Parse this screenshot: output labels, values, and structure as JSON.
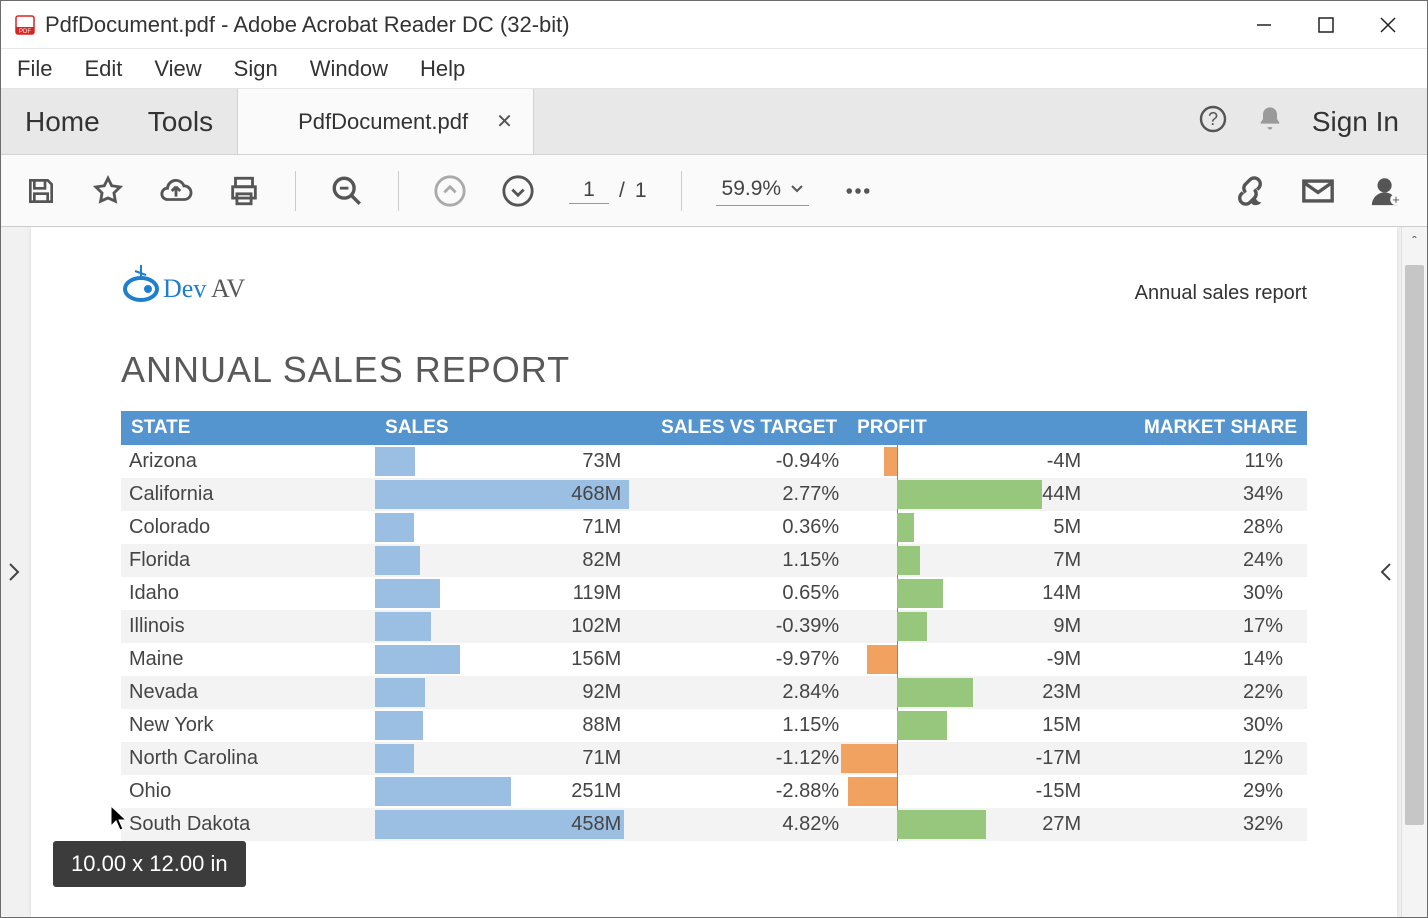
{
  "window": {
    "title": "PdfDocument.pdf - Adobe Acrobat Reader DC (32-bit)"
  },
  "menu": [
    "File",
    "Edit",
    "View",
    "Sign",
    "Window",
    "Help"
  ],
  "tabs": {
    "home": "Home",
    "tools": "Tools",
    "doc": "PdfDocument.pdf"
  },
  "signin": "Sign In",
  "toolbar": {
    "page_current": "1",
    "page_sep": "/",
    "page_total": "1",
    "zoom": "59.9%"
  },
  "doc": {
    "logo_text": "DevAV",
    "subtitle": "Annual sales report",
    "title": "ANNUAL SALES REPORT",
    "headers": {
      "state": "STATE",
      "sales": "SALES",
      "svt": "SALES VS TARGET",
      "profit": "PROFIT",
      "ms": "MARKET SHARE"
    }
  },
  "chart_data": {
    "type": "table",
    "max_sales": 468,
    "max_abs_profit": 44,
    "rows": [
      {
        "state": "Arizona",
        "sales": "73M",
        "sales_n": 73,
        "svt": "-0.94%",
        "svt_neg": true,
        "profit": "-4M",
        "profit_n": -4,
        "ms": "11%"
      },
      {
        "state": "California",
        "sales": "468M",
        "sales_n": 468,
        "svt": "2.77%",
        "svt_neg": false,
        "profit": "44M",
        "profit_n": 44,
        "ms": "34%"
      },
      {
        "state": "Colorado",
        "sales": "71M",
        "sales_n": 71,
        "svt": "0.36%",
        "svt_neg": false,
        "profit": "5M",
        "profit_n": 5,
        "ms": "28%"
      },
      {
        "state": "Florida",
        "sales": "82M",
        "sales_n": 82,
        "svt": "1.15%",
        "svt_neg": false,
        "profit": "7M",
        "profit_n": 7,
        "ms": "24%"
      },
      {
        "state": "Idaho",
        "sales": "119M",
        "sales_n": 119,
        "svt": "0.65%",
        "svt_neg": false,
        "profit": "14M",
        "profit_n": 14,
        "ms": "30%"
      },
      {
        "state": "Illinois",
        "sales": "102M",
        "sales_n": 102,
        "svt": "-0.39%",
        "svt_neg": true,
        "profit": "9M",
        "profit_n": 9,
        "ms": "17%"
      },
      {
        "state": "Maine",
        "sales": "156M",
        "sales_n": 156,
        "svt": "-9.97%",
        "svt_neg": true,
        "profit": "-9M",
        "profit_n": -9,
        "ms": "14%"
      },
      {
        "state": "Nevada",
        "sales": "92M",
        "sales_n": 92,
        "svt": "2.84%",
        "svt_neg": false,
        "profit": "23M",
        "profit_n": 23,
        "ms": "22%"
      },
      {
        "state": "New York",
        "sales": "88M",
        "sales_n": 88,
        "svt": "1.15%",
        "svt_neg": false,
        "profit": "15M",
        "profit_n": 15,
        "ms": "30%"
      },
      {
        "state": "North Carolina",
        "sales": "71M",
        "sales_n": 71,
        "svt": "-1.12%",
        "svt_neg": true,
        "profit": "-17M",
        "profit_n": -17,
        "ms": "12%"
      },
      {
        "state": "Ohio",
        "sales": "251M",
        "sales_n": 251,
        "svt": "-2.88%",
        "svt_neg": true,
        "profit": "-15M",
        "profit_n": -15,
        "ms": "29%"
      },
      {
        "state": "South Dakota",
        "sales": "458M",
        "sales_n": 458,
        "svt": "4.82%",
        "svt_neg": false,
        "profit": "27M",
        "profit_n": 27,
        "ms": "32%"
      }
    ]
  },
  "tooltip": "10.00 x 12.00 in"
}
